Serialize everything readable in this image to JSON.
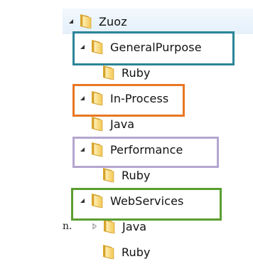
{
  "tree": {
    "root": {
      "label": "Zuoz",
      "toggle": "expanded-arrow-icon",
      "icon": "folder-icon"
    },
    "nodes": [
      {
        "label": "GeneralPurpose",
        "toggle": "expanded-arrow-icon",
        "icon": "folder-icon",
        "group_color": "#2b8596"
      },
      {
        "label": "Ruby",
        "toggle": "none",
        "icon": "folder-icon"
      },
      {
        "label": "In-Process",
        "toggle": "expanded-arrow-icon",
        "icon": "folder-icon",
        "group_color": "#e87722"
      },
      {
        "label": "Java",
        "toggle": "none",
        "icon": "folder-icon"
      },
      {
        "label": "Performance",
        "toggle": "expanded-arrow-icon",
        "icon": "folder-icon",
        "group_color": "#b5a6cf"
      },
      {
        "label": "Ruby",
        "toggle": "none",
        "icon": "folder-icon"
      },
      {
        "label": "WebServices",
        "toggle": "expanded-arrow-icon",
        "icon": "folder-icon",
        "group_color": "#5a9e2f"
      },
      {
        "label": "Java",
        "toggle": "collapsed-arrow-icon",
        "icon": "folder-icon"
      },
      {
        "label": "Ruby",
        "toggle": "none",
        "icon": "folder-icon"
      }
    ]
  },
  "stray_text": "n.",
  "colors": {
    "selection": "#e4f0fb",
    "folder_light": "#fbe38e",
    "folder_dark": "#d9a52a",
    "text": "#111111"
  }
}
